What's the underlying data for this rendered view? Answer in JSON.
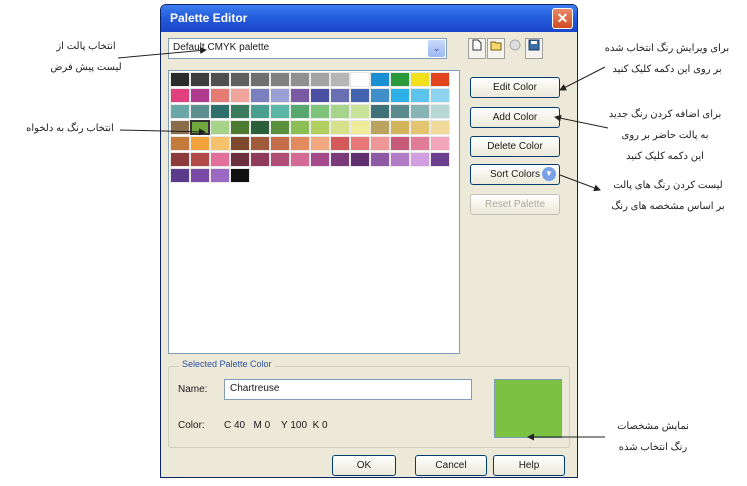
{
  "window": {
    "title": "Palette Editor",
    "close_symbol": "✕"
  },
  "palette_select": {
    "value": "Default CMYK palette",
    "arrow": "⌄"
  },
  "toolbar_icons": [
    "new-palette-icon",
    "open-palette-icon",
    "save-palette-icon",
    "save-as-palette-icon"
  ],
  "buttons": {
    "edit_color": "Edit Color",
    "add_color": "Add Color",
    "delete_color": "Delete Color",
    "sort_colors": "Sort Colors",
    "reset_palette": "Reset Palette",
    "ok": "OK",
    "cancel": "Cancel",
    "help": "Help"
  },
  "selected_color": {
    "group_title": "Selected Palette Color",
    "name_label": "Name:",
    "name_value": "Chartreuse",
    "color_label": "Color:",
    "color_value": "C 40   M 0    Y 100  K 0",
    "preview_hex": "#7cc242"
  },
  "palette_rows": [
    [
      "#2b2b2b",
      "#3d3d3d",
      "#4f4f4f",
      "#5f5f5f",
      "#6f6f6f",
      "#808080",
      "#909090",
      "#a3a3a3",
      "#b6b6b6",
      "#fdfdfd",
      "#1a8fd1",
      "#2a9a3a",
      "#f3e01c",
      "#e2451d"
    ],
    [
      "#e23f7e",
      "#b03a8e",
      "#e57c74",
      "#f0a49b",
      "#7a7fbd",
      "#9aa0d3",
      "#7a5aa3",
      "#4a4fa2",
      "#6a6fb4",
      "#4463b0",
      "#3f8ec9",
      "#2db0e8",
      "#5bc3ec",
      "#8dd3ef"
    ],
    [
      "#6aa7a7",
      "#5e8f8f",
      "#2e6f6b",
      "#3b7a5c",
      "#4a9e8f",
      "#5bb6a5",
      "#57a66e",
      "#7fc27a",
      "#a6d48b",
      "#c9e29a",
      "#3f6f77",
      "#5a8a8e",
      "#87b3b4",
      "#b7d7d5"
    ],
    [
      "#8a6e4a",
      "#6fa83c",
      "#a7d28a",
      "#4b7b2e",
      "#2d5e3a",
      "#5a8f3d",
      "#8bbf55",
      "#b1cf5e",
      "#d6e28a",
      "#f0ea9b",
      "#b9a35e",
      "#d2b45a",
      "#e3c570",
      "#f1d99a"
    ],
    [
      "#c47a3a",
      "#f2a23a",
      "#f6c16b",
      "#7d4a2e",
      "#a05a3c",
      "#c56d4a",
      "#e38a5e",
      "#f1a77f",
      "#d45a5a",
      "#e87878",
      "#ef9696",
      "#c85b7a",
      "#e07c98",
      "#f3a5ba"
    ],
    [
      "#8d3a3a",
      "#b24a4a",
      "#e2709a",
      "#6b2e3d",
      "#8e3a58",
      "#b04e76",
      "#d36a95",
      "#a44a8a",
      "#7a3a7a",
      "#5e2e6e",
      "#8e5aa3",
      "#b07ac6",
      "#d19ee0",
      "#6c3f8e"
    ],
    [
      "#5a3a8a",
      "#7a4aa6",
      "#9a6ac2",
      "#111111"
    ]
  ],
  "annotations": {
    "palette_select": [
      "انتخاب پالت از",
      "لیست پیش فرض"
    ],
    "pick_color": "انتخاب رنگ به دلخواه",
    "edit_color": [
      "برای ویرایش رنگ انتخاب شده",
      "بر روی این دکمه کلیک کنید"
    ],
    "add_color": [
      "برای اضافه کردن رنگ جدید",
      "به پالت حاضر بر روی",
      "این دکمه کلیک کنید"
    ],
    "sort_colors": [
      "لیست کردن  رنگ های پالت",
      "بر اساس مشخصه های رنگ"
    ],
    "preview": [
      "نمایش مشخصات",
      "رنگ انتخاب شده"
    ]
  },
  "accent_colors": {
    "title_bar": "#245ddb",
    "dialog_bg": "#ece9d8",
    "close_button": "#d24a22"
  }
}
